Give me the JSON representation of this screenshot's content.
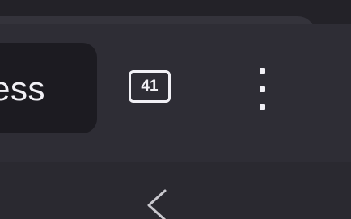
{
  "toolbar": {
    "address_text": "ess",
    "tab_count": "41"
  },
  "icons": {
    "overflow_menu": "vertical-dots-icon",
    "back": "chevron-left-icon"
  },
  "colors": {
    "background": "#2a2930",
    "toolbar": "#2e2d35",
    "address_pill": "#1c1b21",
    "foreground": "#f1f0f5"
  }
}
